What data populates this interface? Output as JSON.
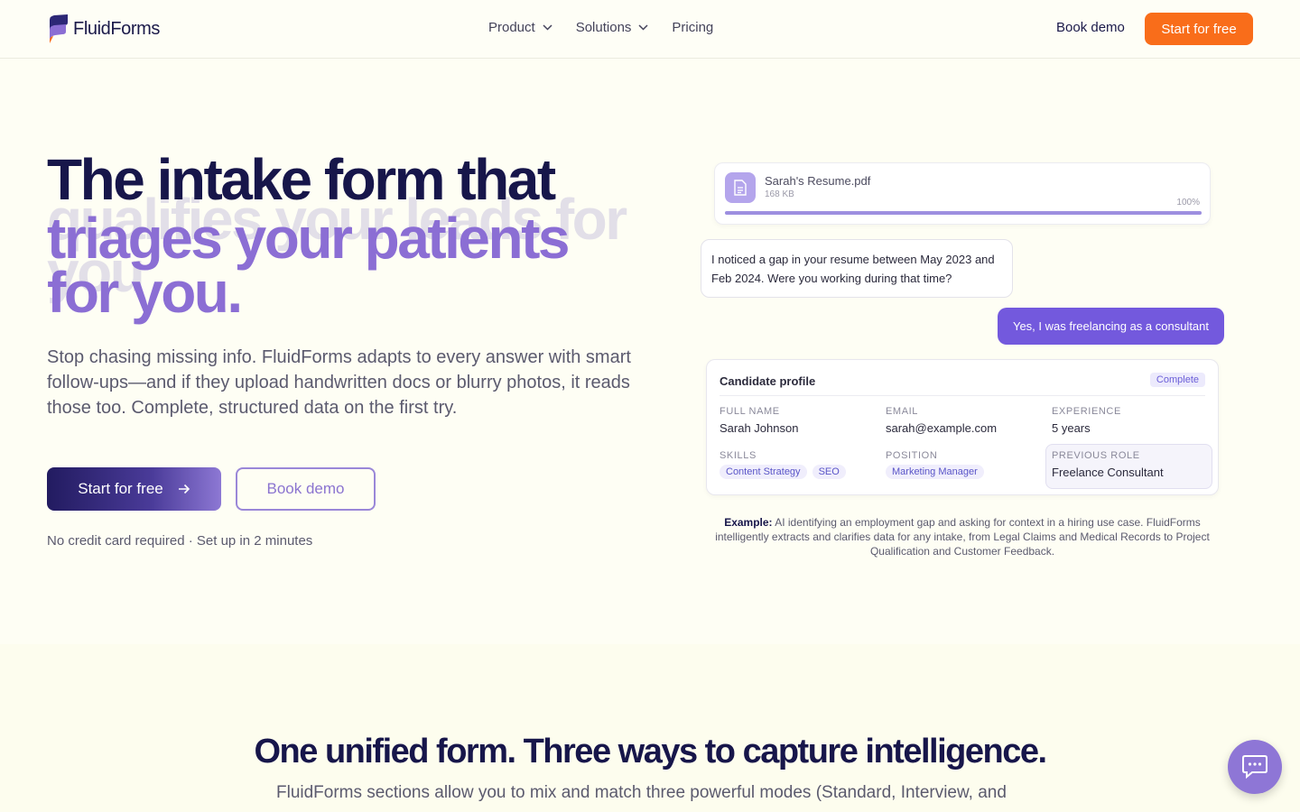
{
  "brand": {
    "name": "FluidForms",
    "accent": "#f96d1a",
    "primary": "#17164a",
    "purple": "#8b6ed4"
  },
  "nav": {
    "links": [
      {
        "label": "Product",
        "has_dropdown": true
      },
      {
        "label": "Solutions",
        "has_dropdown": true
      },
      {
        "label": "Pricing",
        "has_dropdown": false
      }
    ],
    "book_demo": "Book demo",
    "start_free": "Start for free"
  },
  "hero": {
    "title_line1": "The intake form that",
    "rotating_text": "triages your patients for you.",
    "ghost_text": "qualifies your leads for you",
    "subtitle": "Stop chasing missing info. FluidForms adapts to every answer with smart follow-ups—and if they upload handwritten docs or blurry photos, it reads those too. Complete, structured data on the first try.",
    "cta_primary": "Start for free",
    "cta_secondary": "Book demo",
    "note": "No credit card required · Set up in 2 minutes"
  },
  "demo": {
    "file": {
      "name": "Sarah's Resume.pdf",
      "size": "168 KB",
      "progress_label": "100%",
      "progress": 1.0
    },
    "ai_message": "I noticed a gap in your resume between May 2023 and Feb 2024. Were you working during that time?",
    "user_message": "Yes, I was freelancing as a consultant",
    "profile": {
      "title": "Candidate profile",
      "status": "Complete",
      "full_name_label": "FULL NAME",
      "full_name": "Sarah Johnson",
      "email_label": "EMAIL",
      "email": "sarah@example.com",
      "experience_label": "EXPERIENCE",
      "experience": "5 years",
      "skills_label": "SKILLS",
      "skills": [
        "Content Strategy",
        "SEO"
      ],
      "position_label": "POSITION",
      "position": "Marketing Manager",
      "previous_role_label": "PREVIOUS ROLE",
      "previous_role": "Freelance Consultant"
    },
    "caption_bold": "Example:",
    "caption_text": "AI identifying an employment gap and asking for context in a hiring use case. FluidForms intelligently extracts and clarifies data for any intake, from Legal Claims and Medical Records to Project Qualification and Customer Feedback."
  },
  "section2": {
    "title": "One unified form. Three ways to capture intelligence.",
    "subtitle": "FluidForms sections allow you to mix and match three powerful modes (Standard, Interview, and"
  },
  "chat_widget": {
    "icon": "chat-bubble-icon"
  }
}
